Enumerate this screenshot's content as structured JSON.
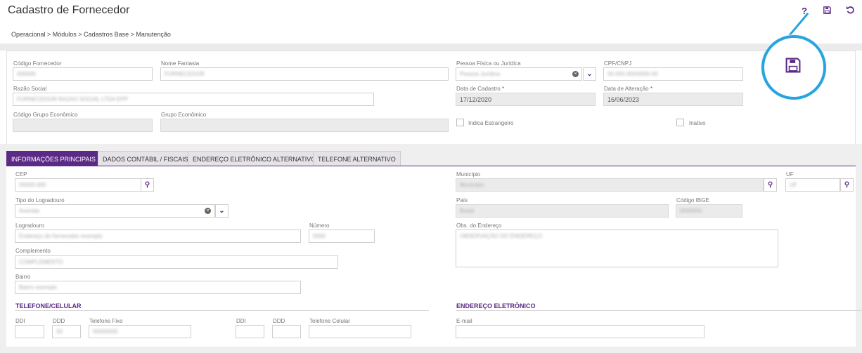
{
  "header": {
    "title": "Cadastro de Fornecedor",
    "breadcrumb": "Operacional  >  Módulos  >  Cadastros Base  >  Manutenção",
    "help_label": "?",
    "save_icon": "floppy-disk-icon",
    "undo_icon": "undo-icon"
  },
  "form": {
    "codigo_fornecedor": {
      "label": "Código Fornecedor",
      "value": "000000"
    },
    "nome_fantasia": {
      "label": "Nome Fantasia",
      "value": "FORNECEDOR"
    },
    "pessoa": {
      "label": "Pessoa Física ou Jurídica",
      "value": "Pessoa Jurídica"
    },
    "cpf_cnpj": {
      "label": "CPF/CNPJ",
      "value": "00.000.000/0000-00"
    },
    "razao_social": {
      "label": "Razão Social",
      "value": "FORNECEDOR RAZAO SOCIAL LTDA EPP"
    },
    "data_cadastro": {
      "label": "Data de Cadastro",
      "value": "17/12/2020"
    },
    "data_alteracao": {
      "label": "Data de Alteração",
      "value": "16/06/2023"
    },
    "codigo_grupo": {
      "label": "Código Grupo Econômico",
      "value": ""
    },
    "grupo": {
      "label": "Grupo Econômico",
      "value": ""
    },
    "indica_estrangeiro": "Indica Estrangeiro",
    "inativo": "Inativo"
  },
  "tabs": [
    {
      "label": "INFORMAÇÕES PRINCIPAIS"
    },
    {
      "label": "DADOS CONTÁBIL / FISCAIS"
    },
    {
      "label": "ENDEREÇO ELETRÔNICO ALTERNATIVO"
    },
    {
      "label": "TELEFONE ALTERNATIVO"
    }
  ],
  "address": {
    "cep": {
      "label": "CEP",
      "value": "00000-000"
    },
    "tipo_logradouro": {
      "label": "Tipo do Logradouro",
      "value": "Avenida"
    },
    "logradouro": {
      "label": "Logradouro",
      "value": "Endereço do fornecedor exemplo"
    },
    "numero": {
      "label": "Número",
      "value": "0000"
    },
    "complemento": {
      "label": "Complemento",
      "value": "COMPLEMENTO"
    },
    "bairro": {
      "label": "Bairro",
      "value": "Bairro exemplo"
    },
    "municipio": {
      "label": "Município",
      "value": "Município"
    },
    "uf": {
      "label": "UF",
      "value": "UF"
    },
    "pais": {
      "label": "País",
      "value": "Brasil"
    },
    "codigo_ibge": {
      "label": "Código IBGE",
      "value": "0000000"
    },
    "obs": {
      "label": "Obs. do Endereço",
      "value": "OBSERVAÇÃO DO ENDEREÇO"
    }
  },
  "phone": {
    "section_title": "TELEFONE/CELULAR",
    "ddi1": "DDI",
    "ddd1": "DDD",
    "fixo": "Telefone Fixo",
    "ddi2": "DDI",
    "ddd2": "DDD",
    "celular": "Telefone Celular",
    "ddd1_value": "00",
    "fixo_value": "00000000"
  },
  "email": {
    "section_title": "ENDEREÇO ELETRÔNICO",
    "label": "E-mail"
  },
  "colors": {
    "accent": "#5b2a86",
    "highlight": "#29a3de"
  }
}
